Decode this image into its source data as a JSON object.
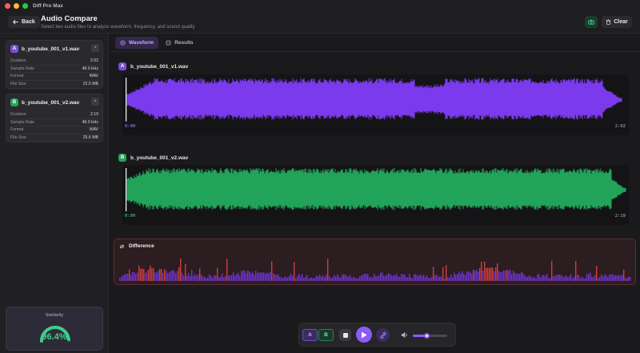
{
  "app_title": "Diff Pro Max",
  "header": {
    "back_label": "Back",
    "title": "Audio Compare",
    "subtitle": "Select two audio files to analyze waveform, frequency, and sound quality",
    "clear_label": "Clear"
  },
  "files": [
    {
      "badge": "A",
      "name": "b_youtube_001_v1.wav",
      "close": "×",
      "rows": [
        {
          "label": "Duration",
          "value": "2:02"
        },
        {
          "label": "Sample Rate",
          "value": "48.0 kHz"
        },
        {
          "label": "Format",
          "value": "WAV"
        },
        {
          "label": "File Size",
          "value": "22.5 MB"
        }
      ]
    },
    {
      "badge": "B",
      "name": "b_youtube_001_v2.wav",
      "close": "×",
      "rows": [
        {
          "label": "Duration",
          "value": "2:19"
        },
        {
          "label": "Sample Rate",
          "value": "48.0 kHz"
        },
        {
          "label": "Format",
          "value": "WAV"
        },
        {
          "label": "File Size",
          "value": "25.6 MB"
        }
      ]
    }
  ],
  "similarity": {
    "label": "Similarity",
    "value": "96.4%",
    "fraction": 0.964
  },
  "tabs": [
    {
      "label": "Waveform",
      "active": true
    },
    {
      "label": "Results",
      "active": false
    }
  ],
  "waveforms": [
    {
      "badge": "A",
      "name": "b_youtube_001_v1.wav",
      "start": "0:00",
      "end": "2:02",
      "color": "#7c3aed",
      "accent": "#a78bfa"
    },
    {
      "badge": "B",
      "name": "b_youtube_001_v2.wav",
      "start": "0:00",
      "end": "2:19",
      "color": "#22a35a",
      "accent": "#4ade80"
    }
  ],
  "difference": {
    "label": "Difference",
    "color_low": "#7c3aed",
    "color_high": "#ef4444"
  },
  "player": {
    "a_label": "A",
    "b_label": "B",
    "volume": 0.4
  },
  "colors": {
    "accent": "#8b5cf6",
    "green": "#3ed08b",
    "danger": "#ef4444"
  }
}
